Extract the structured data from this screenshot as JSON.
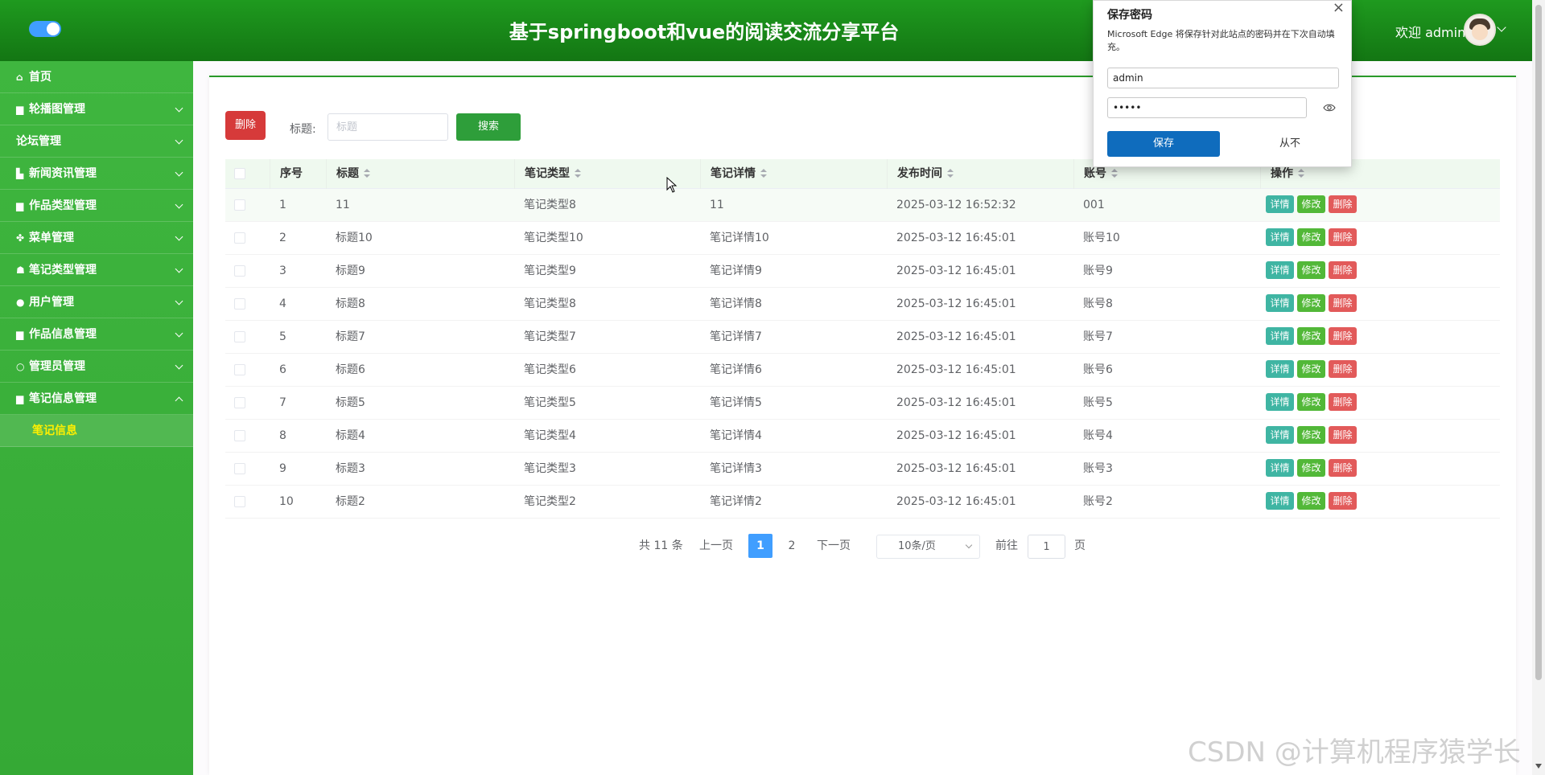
{
  "header": {
    "title": "基于springboot和vue的阅读交流分享平台",
    "welcome": "欢迎 admin"
  },
  "sidebar": {
    "items": [
      {
        "label": "首页",
        "icon": "home-icon",
        "glyph": "⌂"
      },
      {
        "label": "轮播图管理",
        "icon": "folder-icon",
        "glyph": "▆"
      },
      {
        "label": "论坛管理",
        "icon": "",
        "glyph": ""
      },
      {
        "label": "新闻资讯管理",
        "icon": "news-icon",
        "glyph": "▙"
      },
      {
        "label": "作品类型管理",
        "icon": "folder-icon",
        "glyph": "▆"
      },
      {
        "label": "菜单管理",
        "icon": "menu-icon",
        "glyph": "✤"
      },
      {
        "label": "笔记类型管理",
        "icon": "house-icon",
        "glyph": "☗"
      },
      {
        "label": "用户管理",
        "icon": "user-icon",
        "glyph": "●"
      },
      {
        "label": "作品信息管理",
        "icon": "folder-icon",
        "glyph": "▆"
      },
      {
        "label": "管理员管理",
        "icon": "admin-icon",
        "glyph": "○"
      },
      {
        "label": "笔记信息管理",
        "icon": "folder-icon",
        "glyph": "▆"
      }
    ],
    "sub_active": "笔记信息"
  },
  "toolbar": {
    "delete_label": "删除",
    "search_label": "标题:",
    "search_placeholder": "标题",
    "search_button": "搜索"
  },
  "table": {
    "columns": [
      "序号",
      "标题",
      "笔记类型",
      "笔记详情",
      "发布时间",
      "账号",
      "操作"
    ],
    "rows": [
      [
        "1",
        "11",
        "笔记类型8",
        "11",
        "2025-03-12 16:52:32",
        "001"
      ],
      [
        "2",
        "标题10",
        "笔记类型10",
        "笔记详情10",
        "2025-03-12 16:45:01",
        "账号10"
      ],
      [
        "3",
        "标题9",
        "笔记类型9",
        "笔记详情9",
        "2025-03-12 16:45:01",
        "账号9"
      ],
      [
        "4",
        "标题8",
        "笔记类型8",
        "笔记详情8",
        "2025-03-12 16:45:01",
        "账号8"
      ],
      [
        "5",
        "标题7",
        "笔记类型7",
        "笔记详情7",
        "2025-03-12 16:45:01",
        "账号7"
      ],
      [
        "6",
        "标题6",
        "笔记类型6",
        "笔记详情6",
        "2025-03-12 16:45:01",
        "账号6"
      ],
      [
        "7",
        "标题5",
        "笔记类型5",
        "笔记详情5",
        "2025-03-12 16:45:01",
        "账号5"
      ],
      [
        "8",
        "标题4",
        "笔记类型4",
        "笔记详情4",
        "2025-03-12 16:45:01",
        "账号4"
      ],
      [
        "9",
        "标题3",
        "笔记类型3",
        "笔记详情3",
        "2025-03-12 16:45:01",
        "账号3"
      ],
      [
        "10",
        "标题2",
        "笔记类型2",
        "笔记详情2",
        "2025-03-12 16:45:01",
        "账号2"
      ]
    ],
    "actions": {
      "detail": "详情",
      "edit": "修改",
      "remove": "删除"
    }
  },
  "pagination": {
    "total": "共 11 条",
    "prev": "上一页",
    "pages": [
      "1",
      "2"
    ],
    "current": "1",
    "next": "下一页",
    "page_size": "10条/页",
    "goto_label": "前往",
    "goto_value": "1",
    "goto_suffix": "页"
  },
  "password_dialog": {
    "title": "保存密码",
    "description": "Microsoft Edge 将保存针对此站点的密码并在下次自动填充。",
    "username": "admin",
    "password": "•••••",
    "save": "保存",
    "never": "从不"
  },
  "watermark": "CSDN @计算机程序猿学长",
  "colors": {
    "header": "#1a8c1a",
    "sidebar": "#3bb03b",
    "active_sub": "#ffef00",
    "primary": "#409eff",
    "edge_blue": "#0f6cbd"
  }
}
